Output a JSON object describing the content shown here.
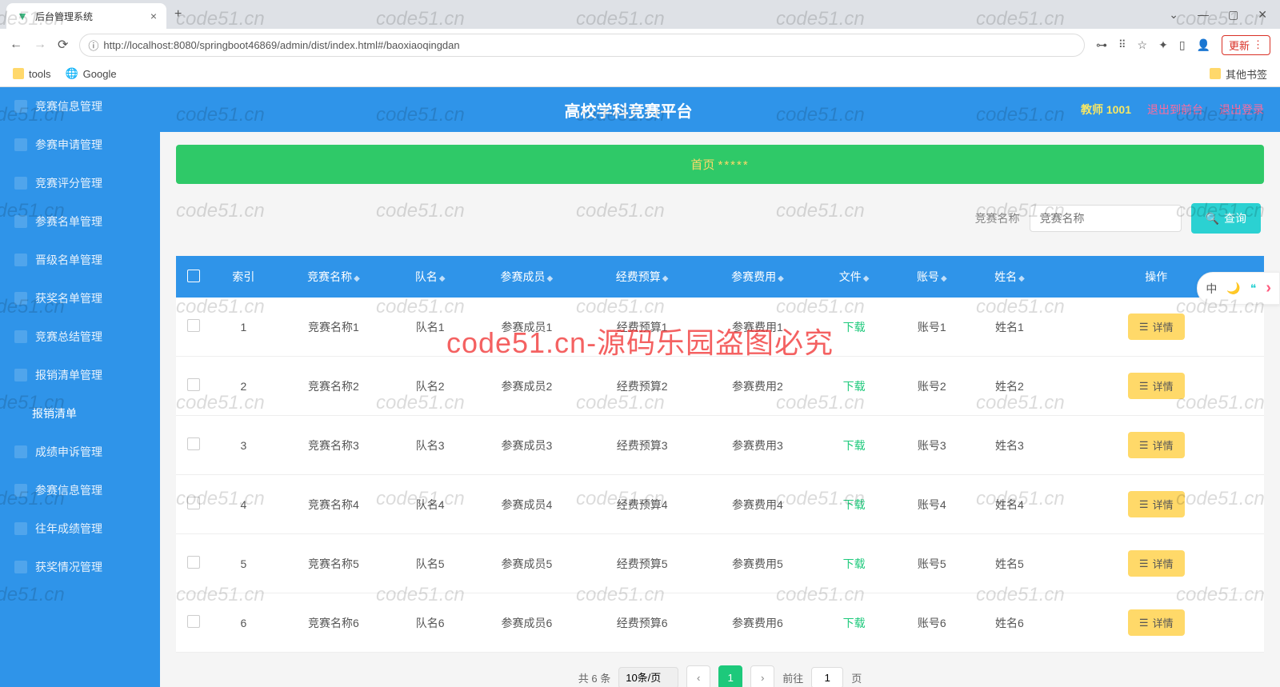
{
  "browser": {
    "tab_title": "后台管理系统",
    "url": "http://localhost:8080/springboot46869/admin/dist/index.html#/baoxiaoqingdan",
    "update_label": "更新",
    "bookmarks": {
      "tools": "tools",
      "google": "Google",
      "other": "其他书签"
    }
  },
  "header": {
    "title": "高校学科竞赛平台",
    "user": "教师 1001",
    "to_front": "退出到前台",
    "logout": "退出登录"
  },
  "sidebar": {
    "items": [
      "竞赛信息管理",
      "参赛申请管理",
      "竞赛评分管理",
      "参赛名单管理",
      "晋级名单管理",
      "获奖名单管理",
      "竞赛总结管理",
      "报销清单管理",
      "报销清单",
      "成绩申诉管理",
      "参赛信息管理",
      "往年成绩管理",
      "获奖情况管理"
    ]
  },
  "breadcrumb": {
    "home": "首页",
    "stars": "*****"
  },
  "search": {
    "label": "竞赛名称",
    "placeholder": "竞赛名称",
    "button": "查询"
  },
  "table": {
    "headers": [
      "索引",
      "竞赛名称",
      "队名",
      "参赛成员",
      "经费预算",
      "参赛费用",
      "文件",
      "账号",
      "姓名",
      "操作"
    ],
    "download_label": "下载",
    "detail_label": "详情",
    "rows": [
      {
        "idx": "1",
        "name": "竞赛名称1",
        "team": "队名1",
        "member": "参赛成员1",
        "budget": "经费预算1",
        "fee": "参赛费用1",
        "account": "账号1",
        "person": "姓名1"
      },
      {
        "idx": "2",
        "name": "竞赛名称2",
        "team": "队名2",
        "member": "参赛成员2",
        "budget": "经费预算2",
        "fee": "参赛费用2",
        "account": "账号2",
        "person": "姓名2"
      },
      {
        "idx": "3",
        "name": "竞赛名称3",
        "team": "队名3",
        "member": "参赛成员3",
        "budget": "经费预算3",
        "fee": "参赛费用3",
        "account": "账号3",
        "person": "姓名3"
      },
      {
        "idx": "4",
        "name": "竞赛名称4",
        "team": "队名4",
        "member": "参赛成员4",
        "budget": "经费预算4",
        "fee": "参赛费用4",
        "account": "账号4",
        "person": "姓名4"
      },
      {
        "idx": "5",
        "name": "竞赛名称5",
        "team": "队名5",
        "member": "参赛成员5",
        "budget": "经费预算5",
        "fee": "参赛费用5",
        "account": "账号5",
        "person": "姓名5"
      },
      {
        "idx": "6",
        "name": "竞赛名称6",
        "team": "队名6",
        "member": "参赛成员6",
        "budget": "经费预算6",
        "fee": "参赛费用6",
        "account": "账号6",
        "person": "姓名6"
      }
    ]
  },
  "pagination": {
    "total": "共 6 条",
    "page_size": "10条/页",
    "current": "1",
    "goto_prefix": "前往",
    "goto_value": "1",
    "goto_suffix": "页"
  },
  "watermark": {
    "text": "code51.cn",
    "banner": "code51.cn-源码乐园盗图必究"
  },
  "side_tool": {
    "lang": "中",
    "moon": "🌙",
    "quote": "❝",
    "arrow": "›"
  }
}
